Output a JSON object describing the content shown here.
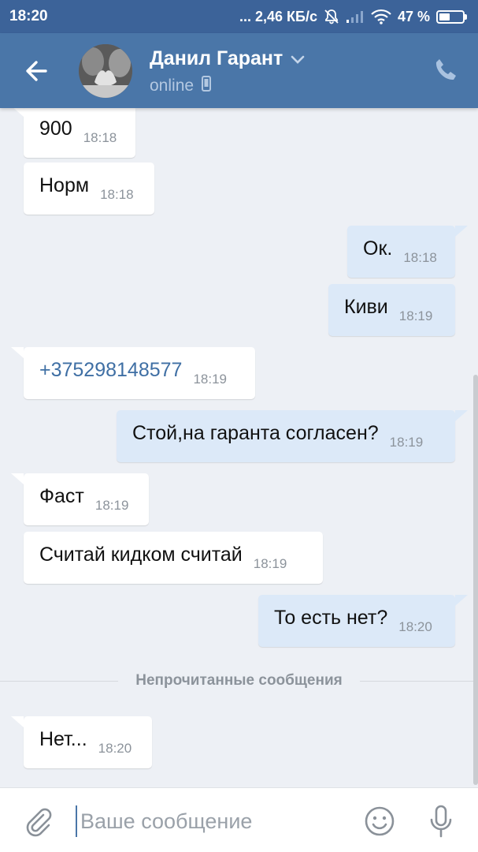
{
  "status_bar": {
    "time": "18:20",
    "network_speed": "... 2,46 КБ/с",
    "battery": "47 %",
    "battery_level": 0.47
  },
  "header": {
    "contact_name": "Данил Гарант",
    "contact_status": "online"
  },
  "messages": [
    {
      "dir": "in",
      "text": "900",
      "time": "18:18"
    },
    {
      "dir": "in",
      "text": "Норм",
      "time": "18:18"
    },
    {
      "dir": "out",
      "text": "Ок.",
      "time": "18:18"
    },
    {
      "dir": "out",
      "text": "Киви",
      "time": "18:19"
    },
    {
      "dir": "in",
      "text": "+375298148577",
      "time": "18:19",
      "link": true
    },
    {
      "dir": "out",
      "text": "Стой,на гаранта согласен?",
      "time": "18:19"
    },
    {
      "dir": "in",
      "text": "Фаст",
      "time": "18:19"
    },
    {
      "dir": "in",
      "text": "Считай кидком считай",
      "time": "18:19"
    },
    {
      "dir": "out",
      "text": "То есть нет?",
      "time": "18:20"
    },
    {
      "dir": "in",
      "text": "Нет...",
      "time": "18:20"
    }
  ],
  "unread_divider": "Непрочитанные сообщения",
  "composer": {
    "placeholder": "Ваше сообщение"
  },
  "icons": {
    "back": "arrow-left-icon",
    "phone": "phone-icon",
    "attach": "paperclip-icon",
    "emoji": "smiley-icon",
    "mic": "microphone-icon"
  },
  "colors": {
    "header": "#4a76a8",
    "status_bar": "#3c6399",
    "incoming_bubble": "#ffffff",
    "outgoing_bubble": "#dce9f8",
    "background": "#edf0f5"
  }
}
